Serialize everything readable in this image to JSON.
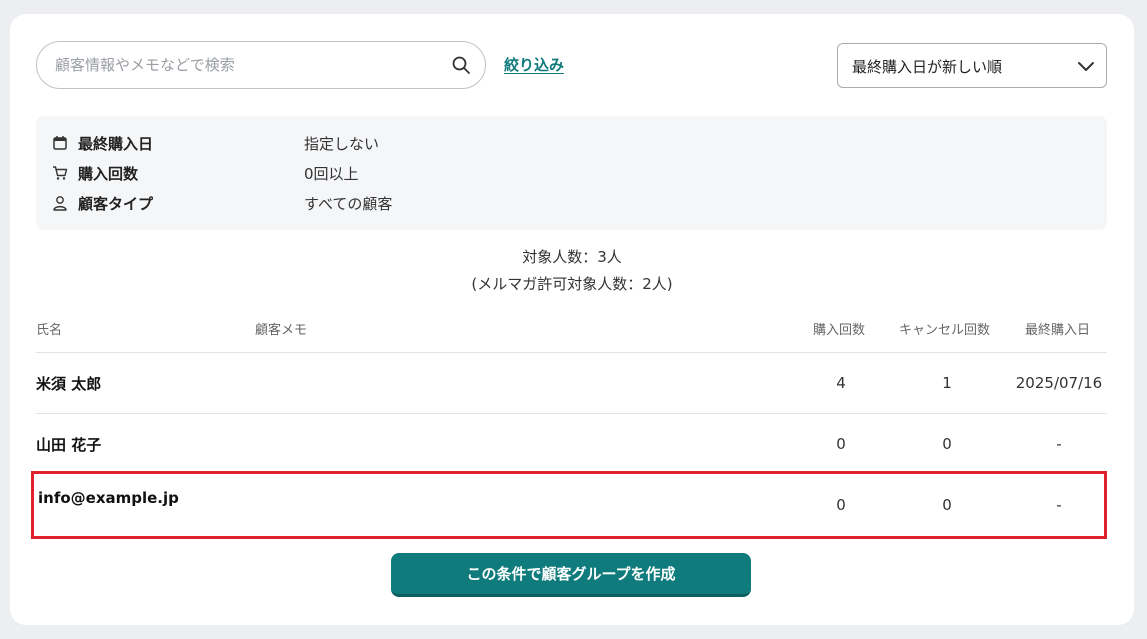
{
  "search": {
    "placeholder": "顧客情報やメモなどで検索",
    "value": ""
  },
  "filter_link": "絞り込み",
  "sort": {
    "selected": "最終購入日が新しい順"
  },
  "conditions": [
    {
      "icon": "calendar-icon",
      "label": "最終購入日",
      "value": "指定しない"
    },
    {
      "icon": "cart-icon",
      "label": "購入回数",
      "value": "0回以上"
    },
    {
      "icon": "person-icon",
      "label": "顧客タイプ",
      "value": "すべての顧客"
    }
  ],
  "counts": {
    "target": "対象人数：3人",
    "newsletter": "(メルマガ許可対象人数：2人)"
  },
  "table": {
    "headers": {
      "name": "氏名",
      "memo": "顧客メモ",
      "purchases": "購入回数",
      "cancels": "キャンセル回数",
      "last_purchase": "最終購入日"
    },
    "rows": [
      {
        "name": "米須 太郎",
        "memo": "",
        "purchases": "4",
        "cancels": "1",
        "last_purchase": "2025/07/16"
      },
      {
        "name": "山田 花子",
        "memo": "",
        "purchases": "0",
        "cancels": "0",
        "last_purchase": "-"
      },
      {
        "name": "info@example.jp",
        "memo": "",
        "purchases": "0",
        "cancels": "0",
        "last_purchase": "-"
      }
    ]
  },
  "cta_label": "この条件で顧客グループを作成",
  "colors": {
    "accent": "#0f7b7c",
    "highlight": "#e0202b",
    "panel": "#f5f6f8"
  }
}
